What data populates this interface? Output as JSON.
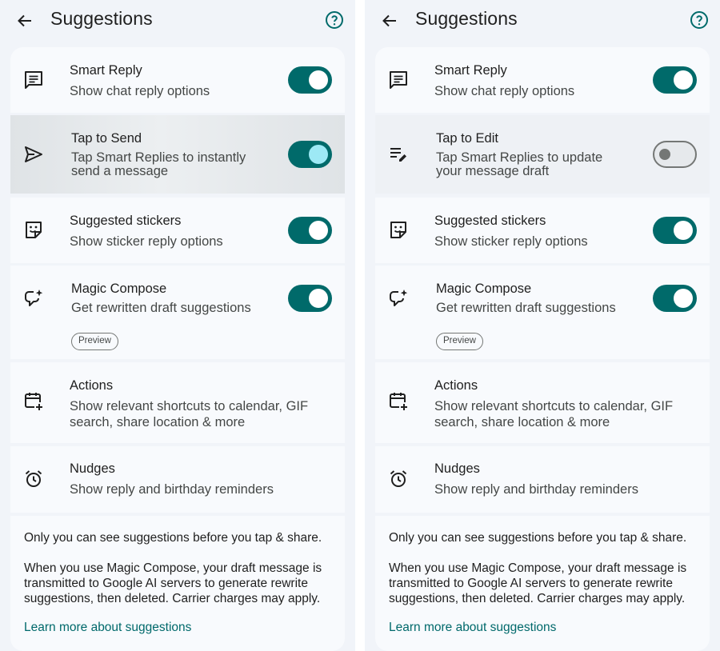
{
  "left_screen": {
    "title": "Suggestions",
    "items": [
      {
        "title": "Smart Reply",
        "subtitle": "Show chat reply options",
        "icon": "chat-bubble-icon",
        "toggle": "on"
      },
      {
        "title": "Tap to Send",
        "subtitle_lines": [
          "Tap Smart Replies to instantly",
          "send a message"
        ],
        "icon": "send-icon",
        "toggle": "on-pressed"
      },
      {
        "title": "Suggested stickers",
        "subtitle": "Show sticker reply options",
        "icon": "sticker-icon",
        "toggle": "on"
      },
      {
        "title": "Magic Compose",
        "subtitle": "Get rewritten draft suggestions",
        "badge": "Preview",
        "icon": "magic-compose-icon",
        "toggle": "on"
      },
      {
        "title": "Actions",
        "subtitle_lines": [
          "Show relevant shortcuts to calendar, GIF",
          "search, share location & more"
        ],
        "icon": "calendar-add-icon"
      },
      {
        "title": "Nudges",
        "subtitle": "Show reply and birthday reminders",
        "icon": "alarm-icon"
      }
    ],
    "footer": {
      "note": "Only you can see suggestions before you tap & share.",
      "paragraph_lines": [
        "When you use Magic Compose, your draft message is",
        "transmitted to Google AI servers to generate rewrite",
        "suggestions, then deleted. Carrier charges may apply."
      ],
      "link": "Learn more about suggestions"
    }
  },
  "right_screen": {
    "title": "Suggestions",
    "items": [
      {
        "title": "Smart Reply",
        "subtitle": "Show chat reply options",
        "icon": "chat-bubble-icon",
        "toggle": "on"
      },
      {
        "title": "Tap to Edit",
        "subtitle_lines": [
          "Tap Smart Replies to update",
          "your message draft"
        ],
        "icon": "edit-note-icon",
        "toggle": "off"
      },
      {
        "title": "Suggested stickers",
        "subtitle": "Show sticker reply options",
        "icon": "sticker-icon",
        "toggle": "on"
      },
      {
        "title": "Magic Compose",
        "subtitle": "Get rewritten draft suggestions",
        "badge": "Preview",
        "icon": "magic-compose-icon",
        "toggle": "on"
      },
      {
        "title": "Actions",
        "subtitle_lines": [
          "Show relevant shortcuts to calendar, GIF",
          "search, share location & more"
        ],
        "icon": "calendar-add-icon"
      },
      {
        "title": "Nudges",
        "subtitle": "Show reply and birthday reminders",
        "icon": "alarm-icon"
      }
    ],
    "footer": {
      "note": "Only you can see suggestions before you tap & share.",
      "paragraph_lines": [
        "When you use Magic Compose, your draft message is",
        "transmitted to Google AI servers to generate rewrite",
        "suggestions, then deleted. Carrier charges may apply."
      ],
      "link": "Learn more about suggestions"
    }
  },
  "colors": {
    "accent": "#006a6a",
    "link": "#00696b",
    "screen_bg": "#f1f4f9",
    "card_bg": "#f8fafd"
  }
}
